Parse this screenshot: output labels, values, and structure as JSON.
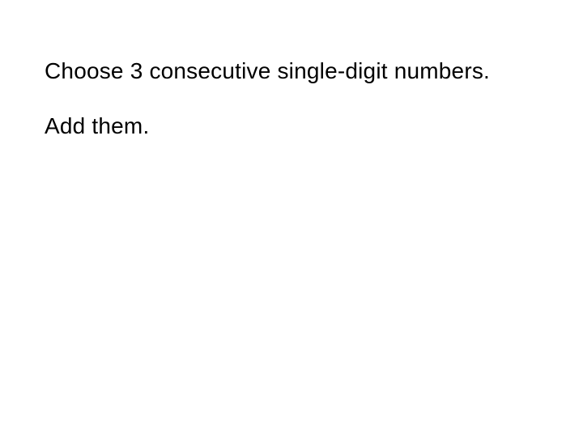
{
  "slide": {
    "line1": "Choose 3 consecutive single-digit numbers.",
    "line2": "Add them."
  }
}
